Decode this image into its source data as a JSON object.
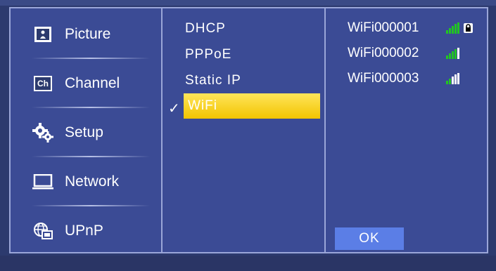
{
  "menu": {
    "items": [
      {
        "label": "Picture",
        "icon": "picture-icon"
      },
      {
        "label": "Channel",
        "icon": "channel-icon"
      },
      {
        "label": "Setup",
        "icon": "gears-icon"
      },
      {
        "label": "Network",
        "icon": "monitor-icon"
      },
      {
        "label": "UPnP",
        "icon": "globe-screen-icon"
      }
    ],
    "channel_icon_text": "Ch"
  },
  "network": {
    "options": [
      "DHCP",
      "PPPoE",
      "Static IP",
      "WiFi"
    ],
    "selected": "WiFi",
    "check": "✓"
  },
  "wifi": {
    "networks": [
      {
        "name": "WiFi000001",
        "secured": true
      },
      {
        "name": "WiFi000002",
        "secured": false
      },
      {
        "name": "WiFi000003",
        "secured": false
      }
    ],
    "ok_label": "OK"
  },
  "colors": {
    "panel": "#3b4b95",
    "highlight": "#f2c400",
    "button": "#5b7ee6"
  }
}
